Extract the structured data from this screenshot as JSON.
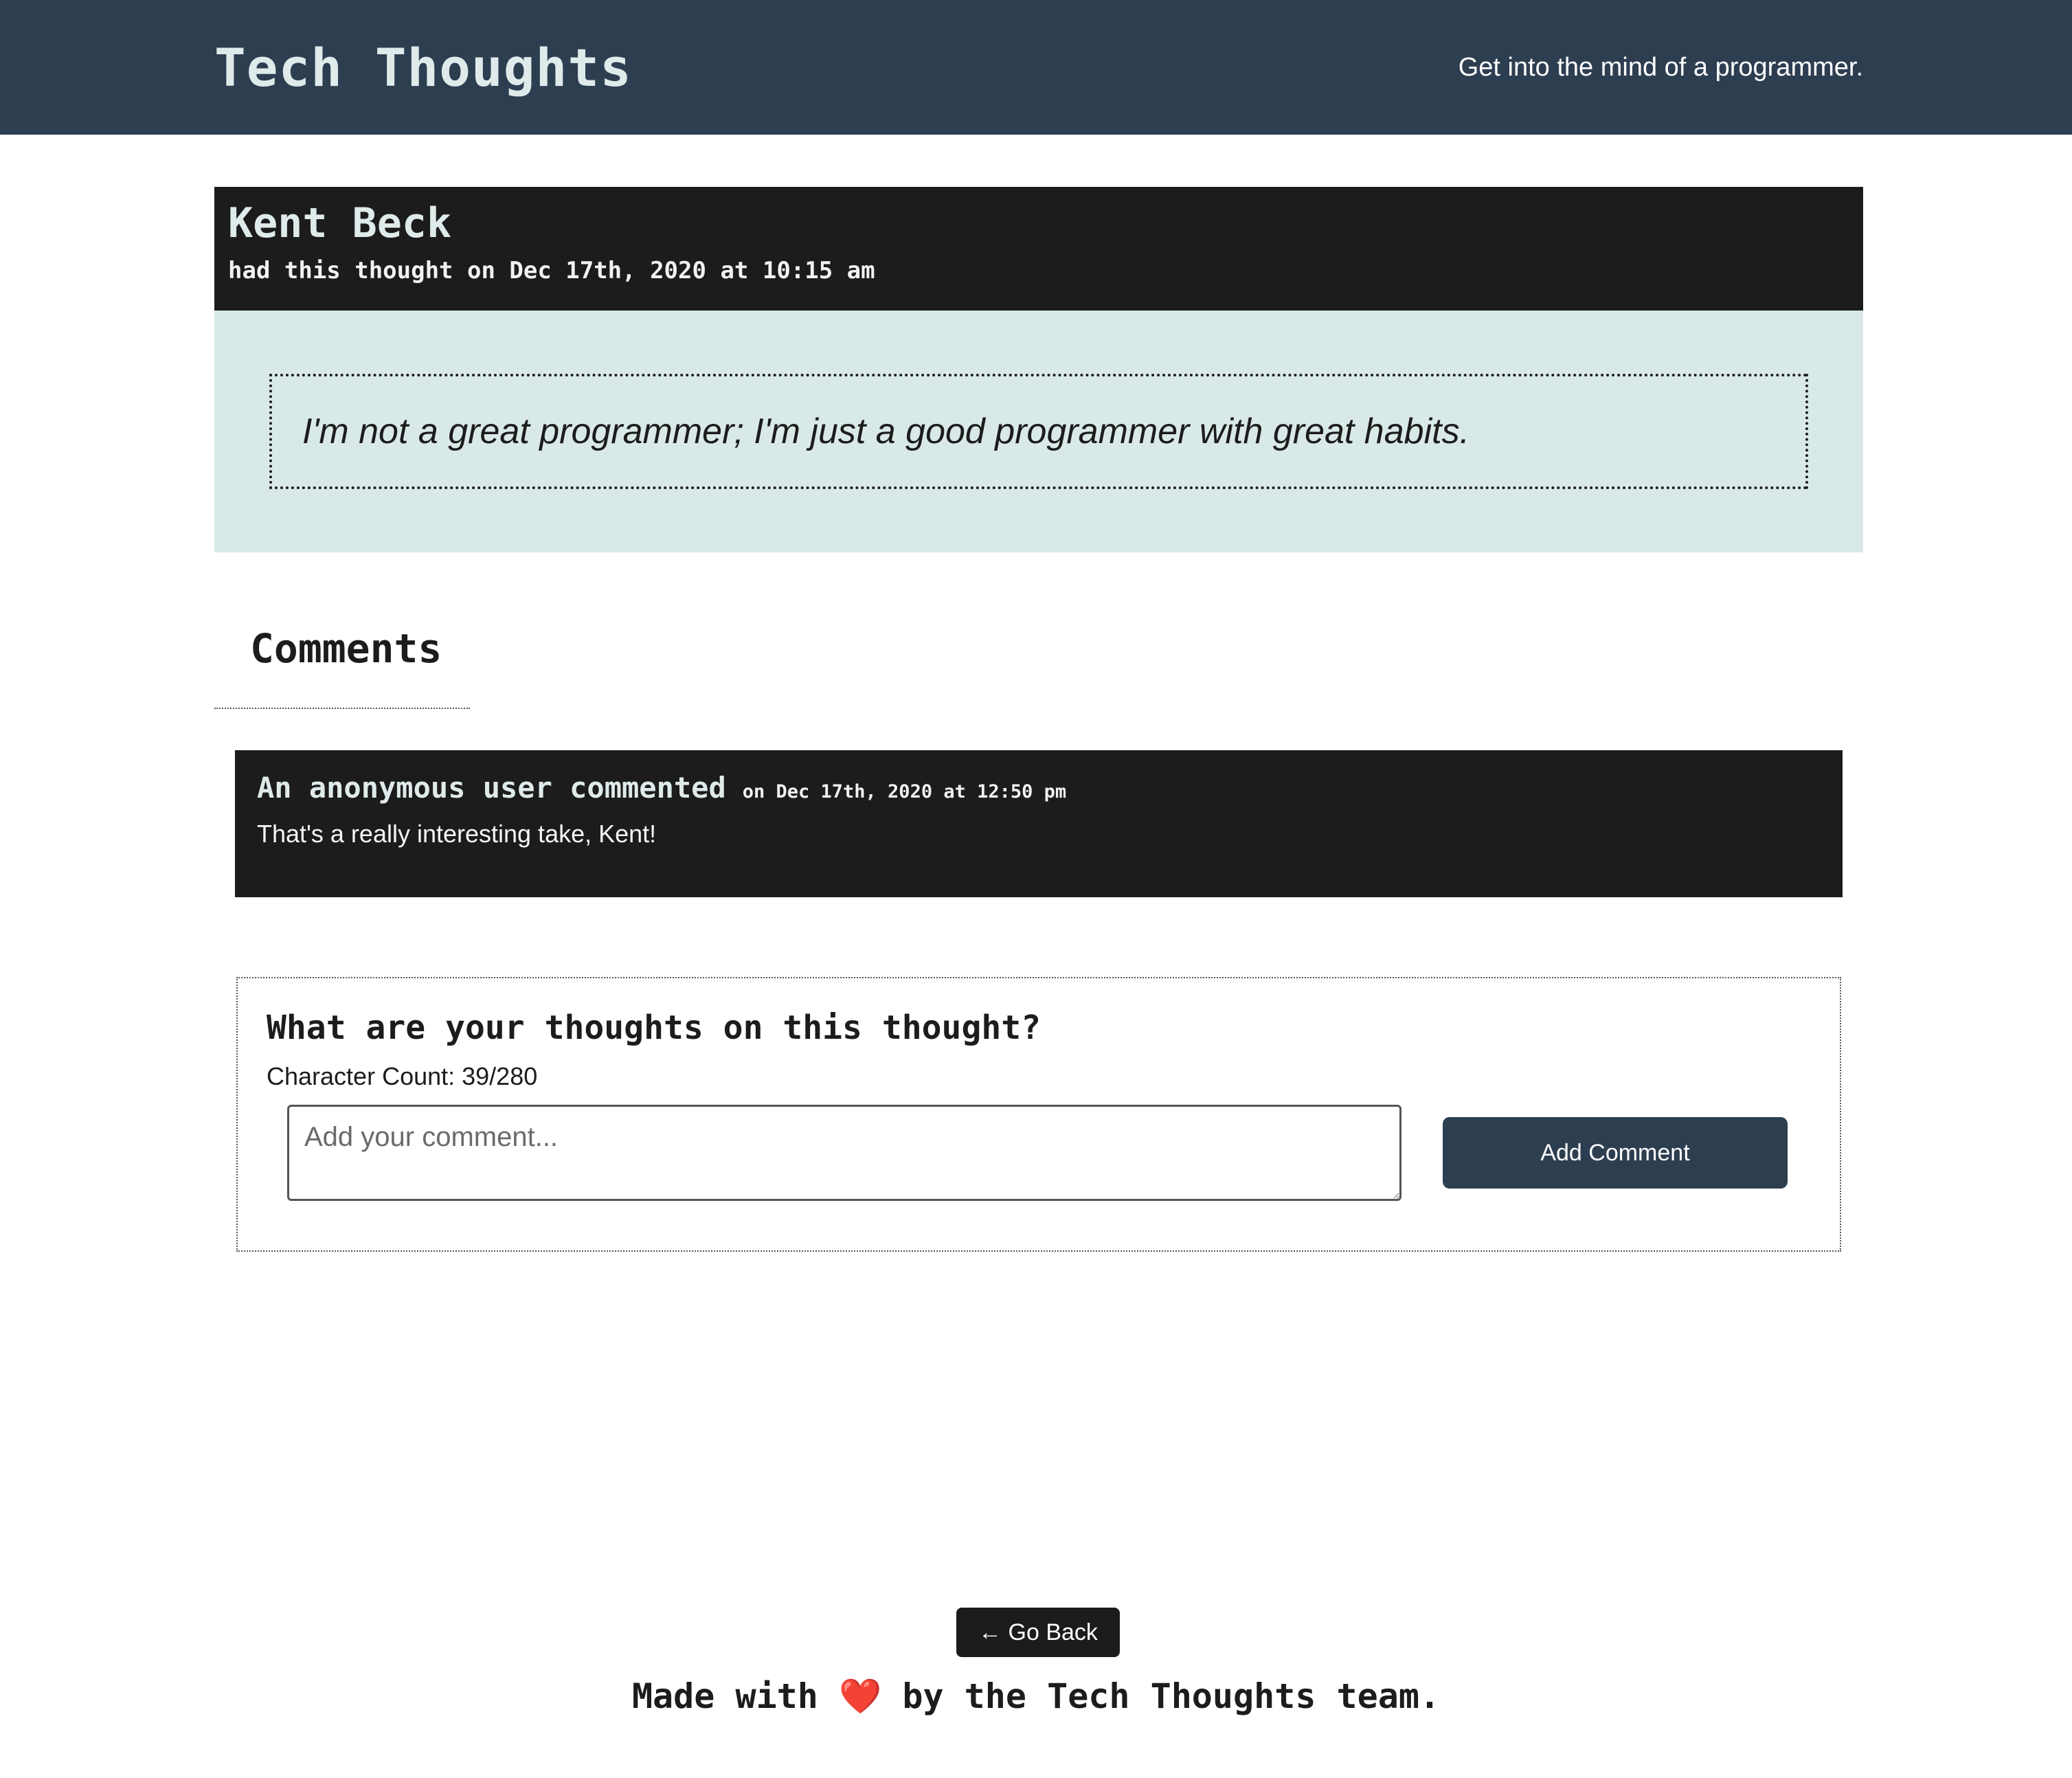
{
  "header": {
    "title": "Tech Thoughts",
    "tagline": "Get into the mind of a programmer."
  },
  "thought": {
    "author": "Kent Beck",
    "meta": "had this thought on Dec 17th, 2020 at 10:15 am",
    "text": "I'm not a great programmer; I'm just a good programmer with great habits."
  },
  "comments": {
    "heading": "Comments",
    "items": [
      {
        "author": "An anonymous user commented",
        "date": "on Dec 17th, 2020 at 12:50 pm",
        "text": "That's a really interesting take, Kent!"
      }
    ]
  },
  "form": {
    "title": "What are your thoughts on this thought?",
    "char_count": "Character Count: 39/280",
    "placeholder": "Add your comment...",
    "button_label": "Add Comment"
  },
  "footer": {
    "back_label": "← Go Back",
    "made_with_prefix": "Made with",
    "heart": "❤️",
    "made_with_suffix": "by the Tech Thoughts team."
  },
  "colors": {
    "header_bg": "#2e3e51",
    "dark_card": "#1c1c1c",
    "quote_bg": "#d9e9e8",
    "heart": "#e0202a"
  }
}
